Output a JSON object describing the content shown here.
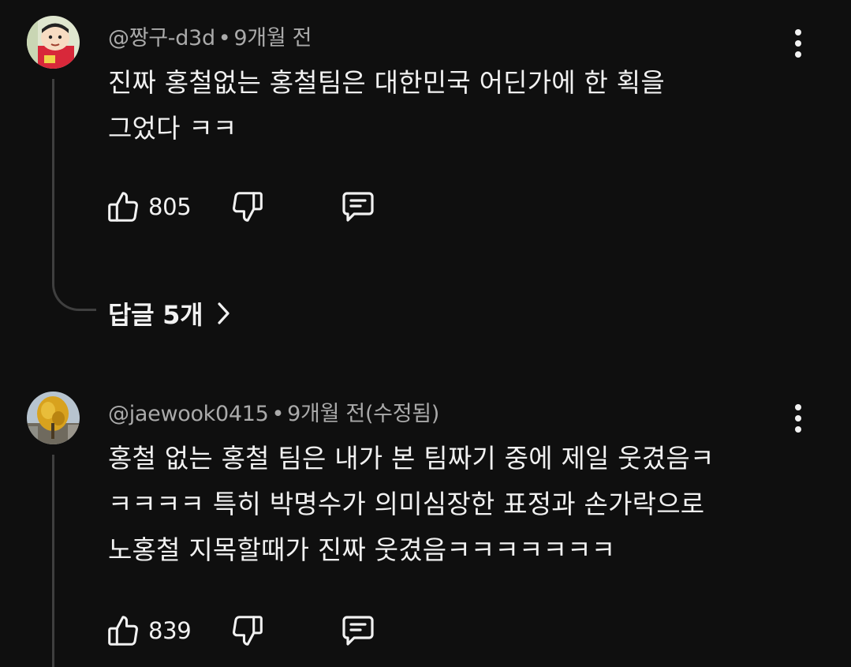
{
  "comments": [
    {
      "author": "@짱구-d3d",
      "time": "9개월 전",
      "edited": "",
      "lines": [
        "진짜 홍철없는 홍철팀은 대한민국 어딘가에 한 획을",
        "그었다 ㅋㅋ"
      ],
      "likes": "805",
      "replies_label": "답글 5개"
    },
    {
      "author": "@jaewook0415",
      "time": "9개월 전",
      "edited": "(수정됨)",
      "lines": [
        "홍철 없는 홍철 팀은 내가 본 팀짜기 중에 제일 웃겼음ㅋ",
        "ㅋㅋㅋㅋ 특히 박명수가 의미심장한 표정과 손가락으로",
        "노홍철 지목할때가 진짜 웃겼음ㅋㅋㅋㅋㅋㅋㅋ"
      ],
      "likes": "839"
    }
  ],
  "separator": "•",
  "icons": {
    "like": "thumbs-up-icon",
    "dislike": "thumbs-down-icon",
    "reply": "reply-comment-icon",
    "more": "more-vert-icon",
    "chevron": "chevron-right-icon"
  },
  "colors": {
    "background": "#0f0f0f",
    "text": "#f1f1f1",
    "secondary": "#aaaaaa",
    "thread": "#3f3f3f"
  }
}
